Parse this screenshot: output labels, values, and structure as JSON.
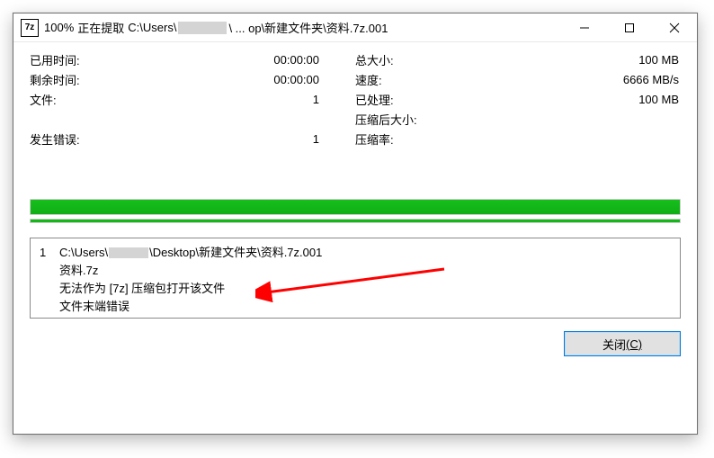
{
  "titlebar": {
    "percent": "100%",
    "action": "正在提取",
    "path_prefix": "C:\\Users\\",
    "path_suffix": "\\ ... op\\新建文件夹\\资料.7z.001"
  },
  "stats": {
    "left": {
      "elapsed_label": "已用时间:",
      "elapsed_value": "00:00:00",
      "remaining_label": "剩余时间:",
      "remaining_value": "00:00:00",
      "files_label": "文件:",
      "files_value": "1",
      "errors_label": "发生错误:",
      "errors_value": "1"
    },
    "right": {
      "total_label": "总大小:",
      "total_value": "100 MB",
      "speed_label": "速度:",
      "speed_value": "6666 MB/s",
      "processed_label": "已处理:",
      "processed_value": "100 MB",
      "packed_label": "压缩后大小:",
      "packed_value": "",
      "ratio_label": "压缩率:",
      "ratio_value": ""
    }
  },
  "progress": {
    "main_percent": 100,
    "sub_percent": 100
  },
  "error_list": {
    "index": "1",
    "path_prefix": "C:\\Users\\",
    "path_suffix": "\\Desktop\\新建文件夹\\资料.7z.001",
    "archive_name": "资料.7z",
    "message1": "无法作为 [7z] 压缩包打开该文件",
    "message2": "文件末端错误"
  },
  "buttons": {
    "close_label": "关闭",
    "close_accel": "(C)"
  }
}
